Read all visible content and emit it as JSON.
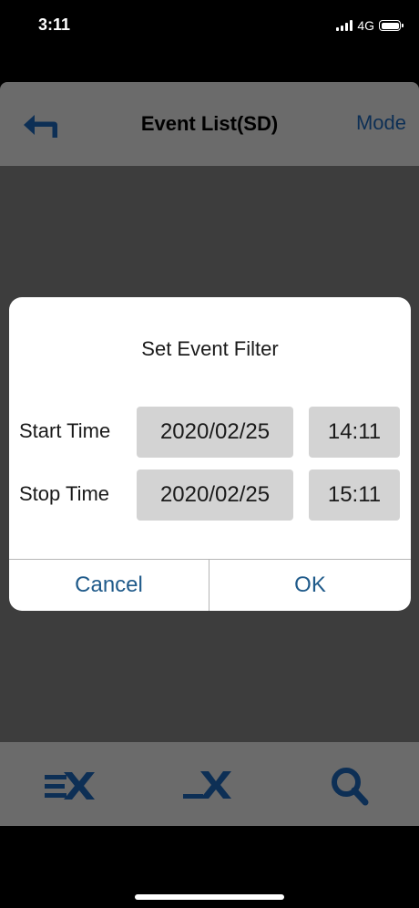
{
  "status_bar": {
    "time": "3:11",
    "network": "4G",
    "icons": [
      "signal-icon",
      "battery-icon"
    ]
  },
  "header": {
    "back_icon": "back-arrow-icon",
    "title": "Event List(SD)",
    "mode_label": "Mode"
  },
  "dialog": {
    "title": "Set Event Filter",
    "start": {
      "label": "Start Time",
      "date": "2020/02/25",
      "time": "14:11"
    },
    "stop": {
      "label": "Stop Time",
      "date": "2020/02/25",
      "time": "15:11"
    },
    "cancel_label": "Cancel",
    "ok_label": "OK"
  },
  "toolbar": {
    "icons": [
      "clear-list-icon",
      "delete-icon",
      "search-icon"
    ]
  },
  "colors": {
    "header_overlay": "#6b6b6b",
    "body_overlay": "#3d3d3d",
    "accent_dim": "#0d2f55",
    "dialog_button": "#1f5a8a",
    "field_bg": "#d3d3d3"
  }
}
